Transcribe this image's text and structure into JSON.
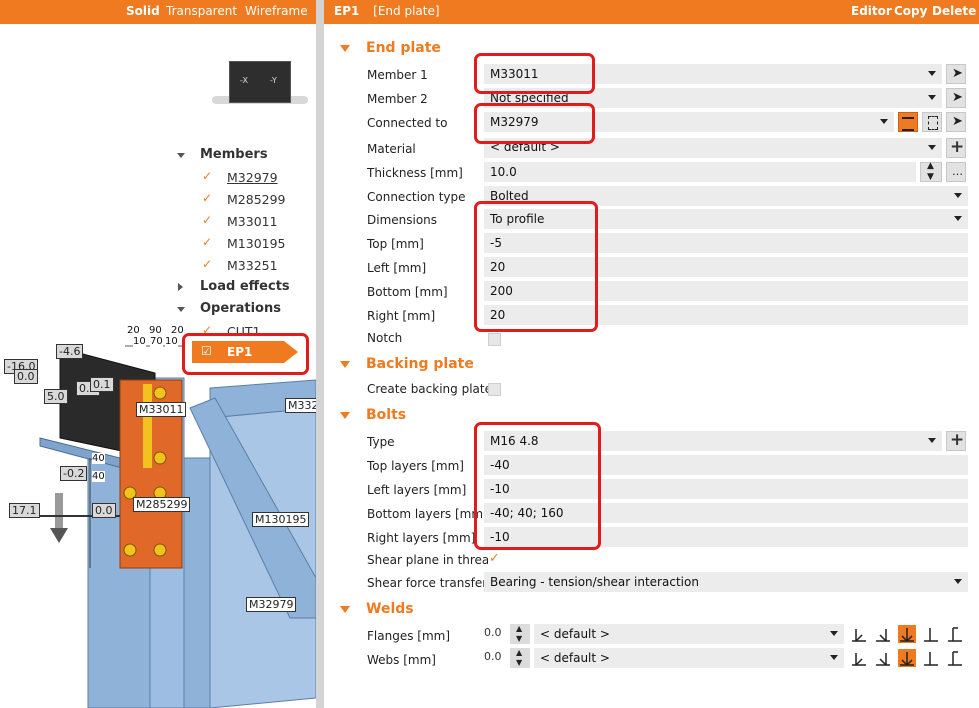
{
  "left_panel": {
    "view_modes": [
      "Solid",
      "Transparent",
      "Wireframe"
    ],
    "active_view_mode": "Solid",
    "cube_labels": [
      "-X",
      "-Y"
    ],
    "tree": {
      "members_label": "Members",
      "members": [
        "M32979",
        "M285299",
        "M33011",
        "M130195",
        "M33251"
      ],
      "load_effects_label": "Load effects",
      "operations_label": "Operations",
      "operations": [
        "CUT1",
        "EP1"
      ],
      "selected_operation": "EP1"
    },
    "scene_labels": {
      "m33011": "M33011",
      "m332": "M332",
      "m285299": "M285299",
      "m130195": "M130195",
      "m32979": "M32979"
    },
    "dims_top": [
      "20",
      "90",
      "20",
      "10",
      "70",
      "10"
    ],
    "dims_side": [
      "40",
      "40"
    ],
    "load_values": [
      "-16.0",
      "0.0",
      "-4.6",
      "0.0",
      "0.1",
      "5.0",
      "-0.2",
      "17.1",
      "0.0"
    ]
  },
  "header": {
    "tag": "EP1",
    "title": "[End plate]",
    "actions": [
      "Editor",
      "Copy",
      "Delete"
    ]
  },
  "end_plate": {
    "title": "End plate",
    "fields": [
      {
        "label": "Member 1",
        "value": "M33011"
      },
      {
        "label": "Member 2",
        "value": "Not specified"
      },
      {
        "label": "Connected to",
        "value": "M32979"
      },
      {
        "label": "Material",
        "value": "< default >"
      },
      {
        "label": "Thickness [mm]",
        "value": "10.0"
      },
      {
        "label": "Connection type",
        "value": "Bolted"
      },
      {
        "label": "Dimensions",
        "value": "To profile"
      },
      {
        "label": "Top [mm]",
        "value": "-5"
      },
      {
        "label": "Left [mm]",
        "value": "20"
      },
      {
        "label": "Bottom [mm]",
        "value": "200"
      },
      {
        "label": "Right [mm]",
        "value": "20"
      },
      {
        "label": "Notch",
        "value": ""
      }
    ]
  },
  "backing_plate": {
    "title": "Backing plate",
    "create_label": "Create backing plate"
  },
  "bolts": {
    "title": "Bolts",
    "fields": [
      {
        "label": "Type",
        "value": "M16 4.8"
      },
      {
        "label": "Top layers [mm]",
        "value": "-40"
      },
      {
        "label": "Left layers [mm]",
        "value": "-10"
      },
      {
        "label": "Bottom layers [mm]",
        "value": "-40; 40; 160"
      },
      {
        "label": "Right layers [mm]",
        "value": "-10"
      },
      {
        "label": "Shear plane in thread",
        "value": ""
      },
      {
        "label": "Shear force transfer",
        "value": "Bearing - tension/shear interaction"
      }
    ]
  },
  "welds": {
    "title": "Welds",
    "rows": [
      {
        "label": "Flanges [mm]",
        "size": "0.0",
        "value": "< default >"
      },
      {
        "label": "Webs [mm]",
        "size": "0.0",
        "value": "< default >"
      }
    ]
  },
  "colors": {
    "accent": "#f07a1f",
    "highlight": "#e21b1b",
    "steel": "#8fb2d9",
    "beam": "#2a2a2a",
    "plate": "#e0692a"
  }
}
